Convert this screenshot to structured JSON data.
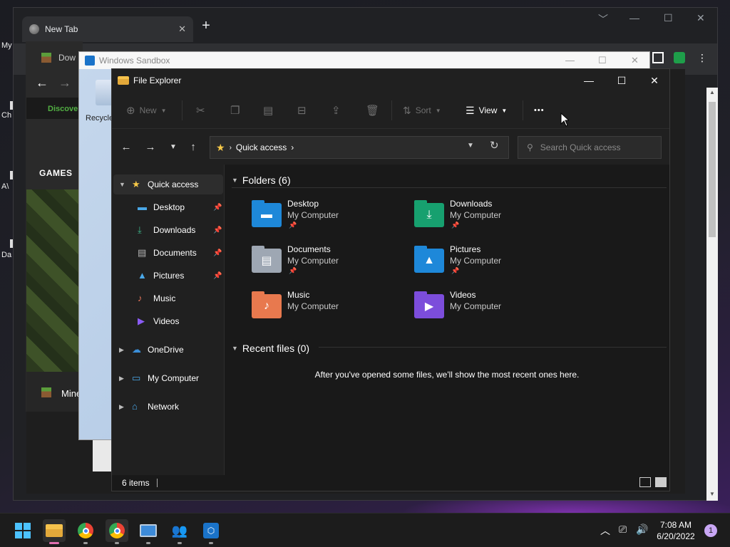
{
  "chrome": {
    "tab_title": "New Tab",
    "tab_close": "✕",
    "new_tab": "+",
    "min": "﹀",
    "minimize": "—",
    "maximize": "☐",
    "close": "✕"
  },
  "desktop_labels": [
    "My",
    "Ch",
    "A\\",
    "Da"
  ],
  "background_app": {
    "tab_peek": "Dow",
    "discover": "Discover",
    "games": "GAMES",
    "footer_label": "Mine"
  },
  "sandbox": {
    "title": "Windows Sandbox",
    "recycle_label": "Recycle"
  },
  "explorer": {
    "title": "File Explorer",
    "commands": {
      "new": "New",
      "sort": "Sort",
      "view": "View",
      "more": "•••"
    },
    "address": {
      "location": "Quick access",
      "search_placeholder": "Search Quick access"
    },
    "nav": [
      {
        "label": "Quick access",
        "icon": "star-icon",
        "color": "#f7c948",
        "expandable": true,
        "expanded": true,
        "selected": true,
        "pinned": false
      },
      {
        "label": "Desktop",
        "icon": "desktop-icon",
        "color": "#4aa8e8",
        "pinned": true
      },
      {
        "label": "Downloads",
        "icon": "download-icon",
        "color": "#3fb68b",
        "pinned": true
      },
      {
        "label": "Documents",
        "icon": "documents-icon",
        "color": "#b5b5b5",
        "pinned": true
      },
      {
        "label": "Pictures",
        "icon": "pictures-icon",
        "color": "#4aa8e8",
        "pinned": true
      },
      {
        "label": "Music",
        "icon": "music-icon",
        "color": "#e9765b",
        "pinned": false
      },
      {
        "label": "Videos",
        "icon": "videos-icon",
        "color": "#8b5cf6",
        "pinned": false
      },
      {
        "label": "OneDrive",
        "icon": "onedrive-icon",
        "color": "#3b8ed8",
        "expandable": true,
        "pinned": false
      },
      {
        "label": "My Computer",
        "icon": "computer-icon",
        "color": "#4aa8e8",
        "expandable": true,
        "pinned": false
      },
      {
        "label": "Network",
        "icon": "network-icon",
        "color": "#4aa8e8",
        "expandable": true,
        "pinned": false
      }
    ],
    "folders_header": "Folders (6)",
    "folders": [
      {
        "name": "Desktop",
        "location": "My Computer",
        "pinned": true,
        "icon": "desktop-folder-icon",
        "color": "#1e88d9"
      },
      {
        "name": "Downloads",
        "location": "My Computer",
        "pinned": true,
        "icon": "downloads-folder-icon",
        "color": "#17a06f"
      },
      {
        "name": "Documents",
        "location": "My Computer",
        "pinned": true,
        "icon": "documents-folder-icon",
        "color": "#9ea7b3"
      },
      {
        "name": "Pictures",
        "location": "My Computer",
        "pinned": true,
        "icon": "pictures-folder-icon",
        "color": "#1e88d9"
      },
      {
        "name": "Music",
        "location": "My Computer",
        "pinned": false,
        "icon": "music-folder-icon",
        "color": "#e8794e"
      },
      {
        "name": "Videos",
        "location": "My Computer",
        "pinned": false,
        "icon": "videos-folder-icon",
        "color": "#7c4ddb"
      }
    ],
    "recent_header": "Recent files (0)",
    "recent_message": "After you've opened some files, we'll show the most recent ones here.",
    "status": "6 items"
  },
  "taskbar": {
    "time": "7:08 AM",
    "date": "6/20/2022",
    "notifications": "1",
    "apps": [
      "start-icon",
      "file-explorer-icon",
      "chrome-icon",
      "brave-icon",
      "remote-desktop-icon",
      "users-icon",
      "sandbox-icon"
    ]
  }
}
